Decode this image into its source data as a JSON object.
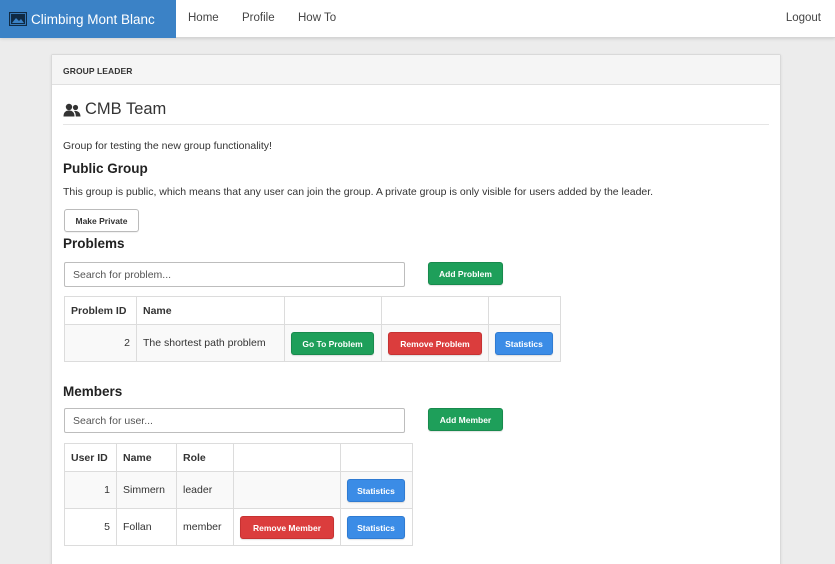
{
  "navbar": {
    "brand": "Climbing Mont Blanc",
    "brand_icon": "picture-icon",
    "links": [
      "Home",
      "Profile",
      "How To"
    ],
    "logout": "Logout"
  },
  "panel": {
    "heading": "GROUP LEADER",
    "team_icon": "users-icon",
    "team_name": "CMB Team",
    "description": "Group for testing the new group functionality!",
    "visibility_title": "Public Group",
    "visibility_text": "This group is public, which means that any user can join the group. A private group is only visible for users added by the leader.",
    "toggle_button": "Make Private"
  },
  "problems": {
    "title": "Problems",
    "search_placeholder": "Search for problem...",
    "add_button": "Add Problem",
    "columns": [
      "Problem ID",
      "Name",
      "",
      "",
      ""
    ],
    "rows": [
      {
        "id": "2",
        "name": "The shortest path problem",
        "go": "Go To Problem",
        "remove": "Remove Problem",
        "stats": "Statistics"
      }
    ]
  },
  "members": {
    "title": "Members",
    "search_placeholder": "Search for user...",
    "add_button": "Add Member",
    "columns": [
      "User ID",
      "Name",
      "Role",
      "",
      ""
    ],
    "rows": [
      {
        "id": "1",
        "name": "Simmern",
        "role": "leader",
        "remove": "",
        "stats": "Statistics"
      },
      {
        "id": "5",
        "name": "Follan",
        "role": "member",
        "remove": "Remove Member",
        "stats": "Statistics"
      }
    ]
  },
  "colors": {
    "brand": "#3b82c6",
    "success": "#1e9f5a",
    "danger": "#db3d3d",
    "primary": "#3b8ce6"
  }
}
